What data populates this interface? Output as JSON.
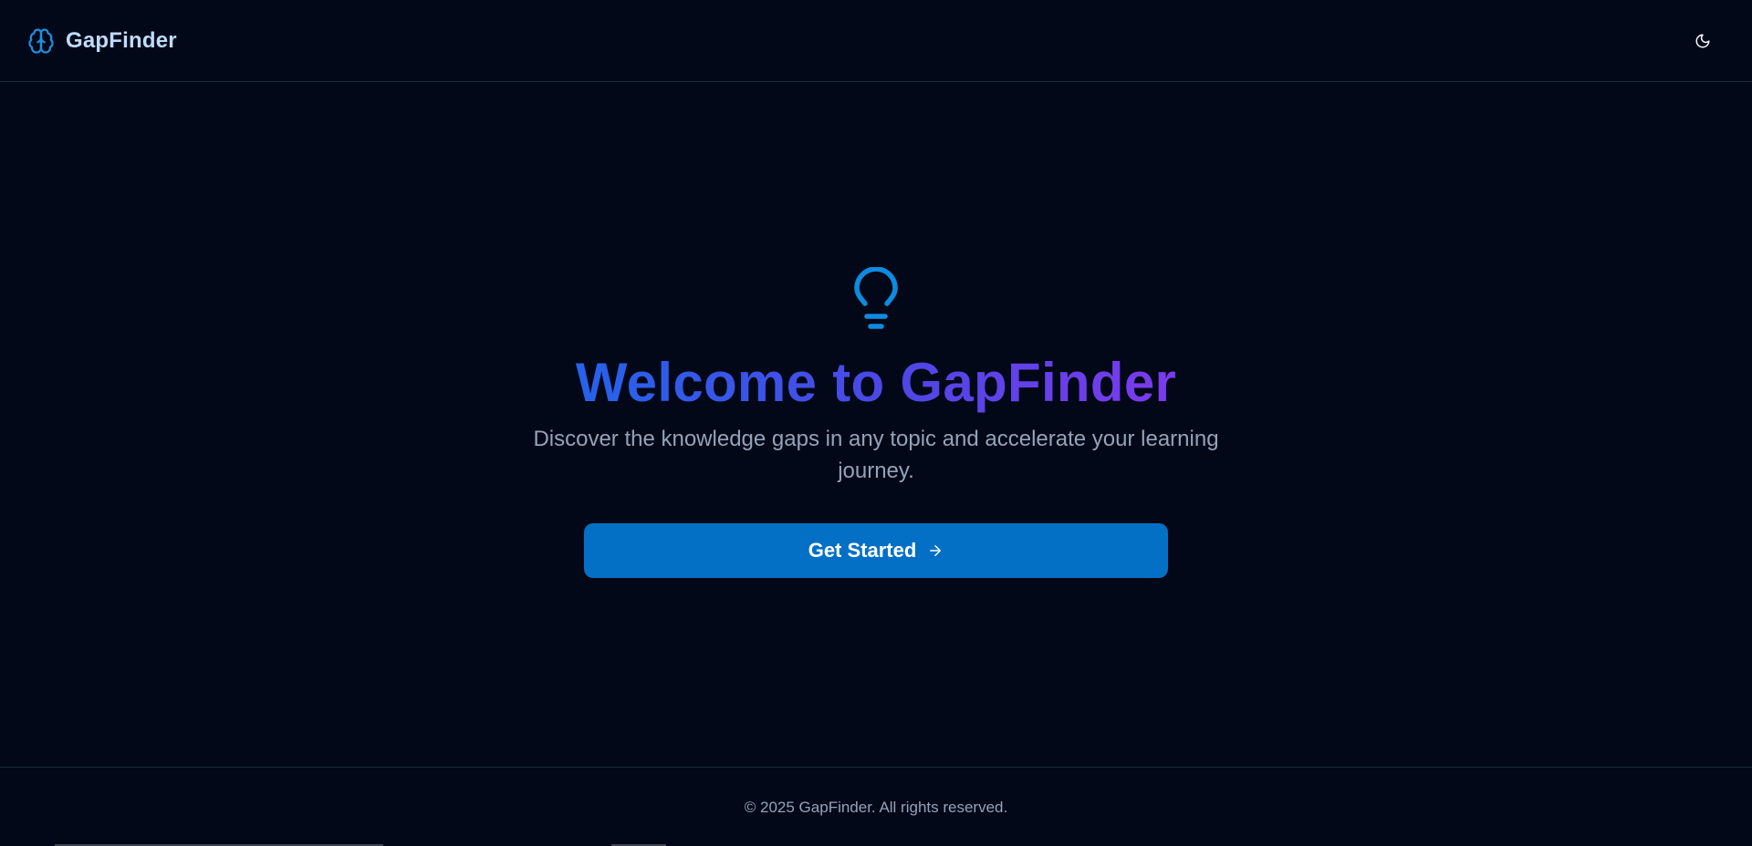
{
  "header": {
    "brand_name": "GapFinder",
    "brand_icon": "brain-icon",
    "theme_toggle_icon": "moon-icon"
  },
  "hero": {
    "icon": "lightbulb-icon",
    "title": "Welcome to GapFinder",
    "subtitle": "Discover the knowledge gaps in any topic and accelerate your learning journey.",
    "cta_label": "Get Started",
    "cta_icon": "arrow-right-icon"
  },
  "footer": {
    "copyright": "© 2025 GapFinder. All rights reserved."
  },
  "colors": {
    "background": "#020817",
    "accent": "#0370c6",
    "brand_text": "#bfdbfe",
    "title_gradient_start": "#2563eb",
    "title_gradient_end": "#7c3aed",
    "muted_text": "#94a3b8",
    "border": "#1e293b"
  }
}
